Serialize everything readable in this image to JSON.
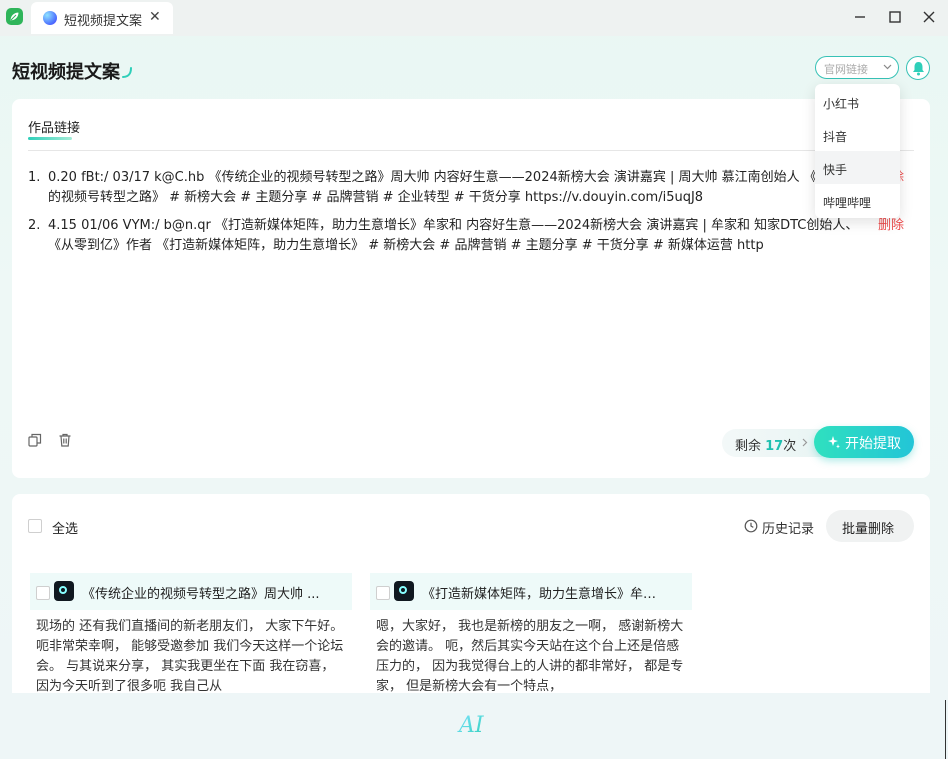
{
  "window": {
    "tab_label": "短视频提文案",
    "close_glyph": "✕"
  },
  "header": {
    "title": "短视频提文案",
    "link_select_label": "官网链接"
  },
  "input_section": {
    "label": "作品链接",
    "links": [
      {
        "num": "1.",
        "text": "0.20 fBt:/ 03/17 k@C.hb 《传统企业的视频号转型之路》周大帅 内容好生意——2024新榜大会 演讲嘉宾 | 周大帅 慕江南创始人 《传统企业的视频号转型之路》 # 新榜大会 # 主题分享 # 品牌营销 # 企业转型 # 干货分享  https://v.douyin.com/i5uqJ8",
        "delete_label": "删除"
      },
      {
        "num": "2.",
        "text": "4.15 01/06 VYM:/ b@n.qr 《打造新媒体矩阵，助力生意增长》牟家和 内容好生意——2024新榜大会 演讲嘉宾 | 牟家和 知家DTC创始人、《从零到亿》作者 《打造新媒体矩阵，助力生意增长》 # 新榜大会 # 品牌营销 # 主题分享 # 干货分享 # 新媒体运营   http",
        "delete_label": "删除"
      }
    ],
    "remaining_prefix": "剩余 ",
    "remaining_count": "17",
    "remaining_suffix": "次",
    "start_label": "开始提取"
  },
  "dropdown": {
    "options": [
      "小红书",
      "抖音",
      "快手",
      "哔哩哔哩"
    ],
    "hovered": "快手"
  },
  "results": {
    "select_all_label": "全选",
    "history_label": "历史记录",
    "batch_delete_label": "批量删除",
    "items": [
      {
        "title": "《传统企业的视频号转型之路》周大帅 ...",
        "body": "现场的 还有我们直播间的新老朋友们， 大家下午好。 呃非常荣幸啊， 能够受邀参加 我们今天这样一个论坛会。 与其说来分享， 其实我更坐在下面 我在窃喜， 因为今天听到了很多呃 我自己从"
      },
      {
        "title": "《打造新媒体矩阵，助力生意增长》牟家...",
        "body": "嗯，大家好， 我也是新榜的朋友之一啊， 感谢新榜大会的邀请。 呃，然后其实今天站在这个台上还是倍感压力的， 因为我觉得台上的人讲的都非常好， 都是专家， 但是新榜大会有一个特点，"
      }
    ]
  },
  "footer": {
    "logo_text": "AI"
  },
  "colors": {
    "accent": "#2ecfb9",
    "delete": "#ee4d4d",
    "count": "#20c0b0"
  }
}
